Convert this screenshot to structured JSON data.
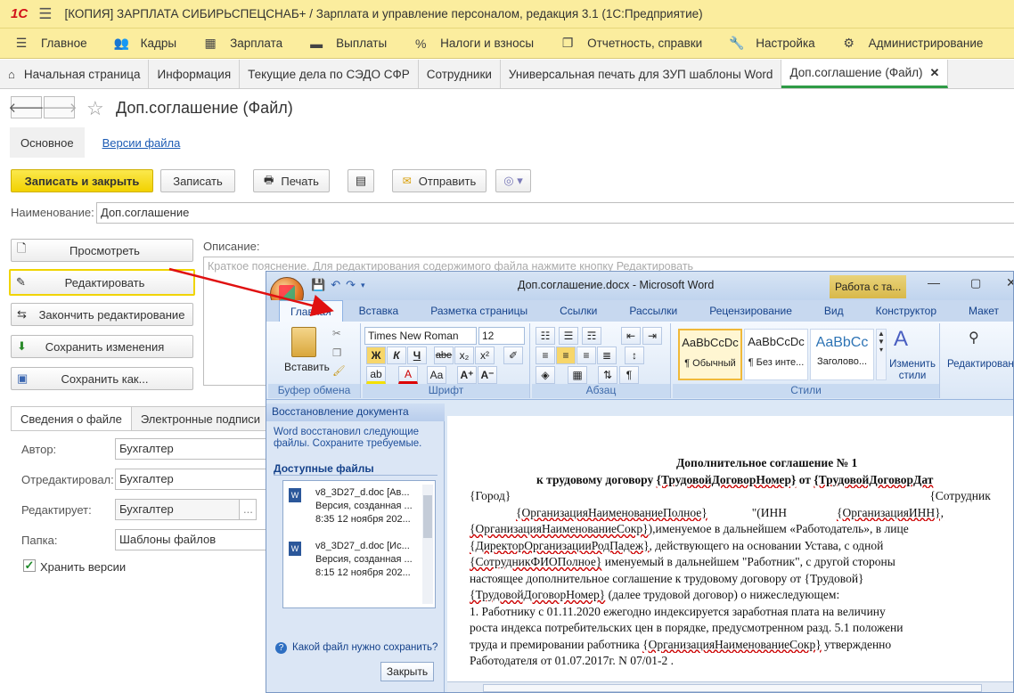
{
  "app": {
    "logo": "1С",
    "title": "[КОПИЯ] ЗАРПЛАТА СИБИРЬСПЕЦСНАБ+ / Зарплата и управление персоналом, редакция 3.1  (1С:Предприятие)"
  },
  "menu": [
    {
      "label": "Главное",
      "icon": "menu-lines-icon"
    },
    {
      "label": "Кадры",
      "icon": "people-icon"
    },
    {
      "label": "Зарплата",
      "icon": "calculator-icon"
    },
    {
      "label": "Выплаты",
      "icon": "cash-icon"
    },
    {
      "label": "Налоги и взносы",
      "icon": "percent-icon"
    },
    {
      "label": "Отчетность, справки",
      "icon": "report-icon"
    },
    {
      "label": "Настройка",
      "icon": "wrench-icon"
    },
    {
      "label": "Администрирование",
      "icon": "gear-icon"
    }
  ],
  "tabs": [
    {
      "label": "Начальная страница"
    },
    {
      "label": "Информация"
    },
    {
      "label": "Текущие дела по СЭДО СФР"
    },
    {
      "label": "Сотрудники"
    },
    {
      "label": "Универсальная печать для ЗУП шаблоны Word"
    },
    {
      "label": "Доп.соглашение (Файл)"
    }
  ],
  "form": {
    "title": "Доп.соглашение (Файл)",
    "subtabs": {
      "main": "Основное",
      "versions": "Версии файла"
    },
    "commands": {
      "save_close": "Записать и закрыть",
      "save": "Записать",
      "print": "Печать",
      "send": "Отправить"
    },
    "name_label": "Наименование:",
    "name_value": "Доп.соглашение",
    "description_label": "Описание:",
    "description_placeholder": "Краткое пояснение. Для редактирования содержимого файла нажмите кнопку Редактировать",
    "side_buttons": {
      "view": "Просмотреть",
      "edit": "Редактировать",
      "finish": "Закончить редактирование",
      "save_changes": "Сохранить изменения",
      "save_as": "Сохранить как..."
    },
    "lower_tabs": {
      "info": "Сведения о файле",
      "signatures": "Электронные подписи"
    },
    "fields": {
      "author_label": "Автор:",
      "author": "Бухгалтер",
      "edited_label": "Отредактировал:",
      "edited": "Бухгалтер",
      "editing_label": "Редактирует:",
      "editing": "Бухгалтер",
      "folder_label": "Папка:",
      "folder": "Шаблоны файлов"
    },
    "keep_versions": "Хранить версии"
  },
  "word": {
    "title": "Доп.соглашение.docx - Microsoft Word",
    "context_title": "Работа с та...",
    "ribbon_tabs": [
      "Главная",
      "Вставка",
      "Разметка страницы",
      "Ссылки",
      "Рассылки",
      "Рецензирование",
      "Вид",
      "Конструктор",
      "Макет"
    ],
    "groups": {
      "clipboard": "Буфер обмена",
      "paste": "Вставить",
      "font": "Шрифт",
      "paragraph": "Абзац",
      "styles": "Стили",
      "change_styles": "Изменить стили",
      "editing": "Редактирование"
    },
    "font_name": "Times New Roman",
    "font_size": "12",
    "format_buttons": [
      "Ж",
      "К",
      "Ч",
      "abe",
      "x₂",
      "x²",
      "Aa",
      "A"
    ],
    "styles": [
      {
        "sample": "AaBbCcDc",
        "name": "¶ Обычный"
      },
      {
        "sample": "AaBbCcDc",
        "name": "¶ Без инте..."
      },
      {
        "sample": "AaBbCc",
        "name": "Заголово..."
      }
    ],
    "recovery": {
      "header": "Восстановление документа",
      "message": "Word восстановил следующие файлы.  Сохраните требуемые.",
      "available": "Доступные файлы",
      "files": [
        {
          "name": "v8_3D27_d.doc  [Ав...",
          "desc": "Версия, созданная ...",
          "time": "8:35 12 ноября 202..."
        },
        {
          "name": "v8_3D27_d.doc  [Ис...",
          "desc": "Версия, созданная ...",
          "time": "8:15 12 ноября 202..."
        }
      ],
      "help": "Какой файл нужно сохранить?",
      "close": "Закрыть"
    },
    "document": {
      "line1": "Дополнительное соглашение № 1",
      "line2a": "к трудовому договору ",
      "line2b": "{ТрудовойДоговорНомер}",
      "line2c": " от ",
      "line2d": "{ТрудовойДоговорДат",
      "city": "{Город}",
      "employee": "{Сотрудник",
      "p1a": "{ОрганизацияНаименованиеПолное}",
      "p1b": "\"(ИНН",
      "p1c": "{ОрганизацияИНН},",
      "p2a": "{ОрганизацияНаименованиеСокр}",
      "p2b": "),именуемое в дальнейшем «Работодатель», в лице",
      "p3a": "{ДиректорОрганизацииРодПадеж}",
      "p3b": ",  действующего  на  основании  Устава,  с  одной",
      "p4a": "{СотрудникФИОПолное}",
      "p4b": "  именуемый  в  дальнейшем  \"Работник\",  с  другой  стороны",
      "p5": "настоящее   дополнительное   соглашение   к   трудовому   договору   от   {Трудовой}",
      "p6a": "{ТрудовойДоговорНомер}",
      "p6b": " (далее трудовой договор) о нижеследующем:",
      "p7": "   1. Работнику с 01.11.2020 ежегодно индексируется  заработная плата  на величину",
      "p8": "роста индекса потребительских цен в порядке, предусмотренном разд. 5.1  положени",
      "p9a": "труда  и  премировании  работника   ",
      "p9b": "{ОрганизацияНаименованиеСокр}",
      "p9c": " утвержденно",
      "p10": "Работодателя от 01.07.2017г. N 07/01-2 ."
    }
  },
  "colors": {
    "accent": "#f2d200",
    "title_bg": "#fbed9e",
    "active_tab": "#2e9b45",
    "arrow": "#e01010"
  }
}
